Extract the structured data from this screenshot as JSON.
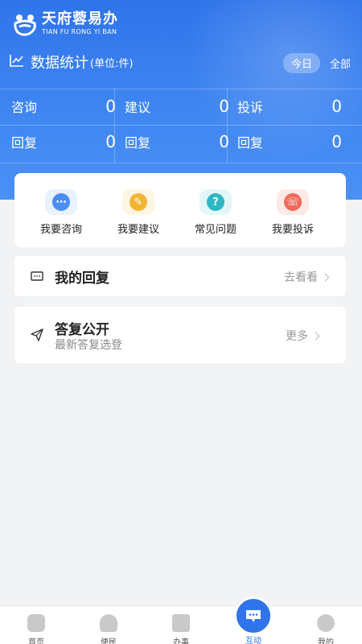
{
  "brand": {
    "name_cn": "天府蓉易办",
    "name_en": "TIAN FU RONG YI BAN"
  },
  "stats": {
    "title": "数据统计",
    "unit": "(单位:件)",
    "range_active": "今日",
    "range_all": "全部",
    "rows": [
      [
        {
          "label": "咨询",
          "value": "0"
        },
        {
          "label": "建议",
          "value": "0"
        },
        {
          "label": "投诉",
          "value": "0"
        }
      ],
      [
        {
          "label": "回复",
          "value": "0"
        },
        {
          "label": "回复",
          "value": "0"
        },
        {
          "label": "回复",
          "value": "0"
        }
      ]
    ]
  },
  "quick_actions": [
    {
      "label": "我要咨询",
      "icon": "consult-chat-icon",
      "color": "#4a8df5",
      "bg": "#eaf2ff"
    },
    {
      "label": "我要建议",
      "icon": "suggest-pencil-icon",
      "color": "#f3b534",
      "bg": "#fff5e3"
    },
    {
      "label": "常见问题",
      "icon": "faq-question-icon",
      "color": "#2fb7c4",
      "bg": "#e4f7f8"
    },
    {
      "label": "我要投诉",
      "icon": "complaint-icon",
      "color": "#f06a5a",
      "bg": "#fde9e6"
    }
  ],
  "my_reply": {
    "title": "我的回复",
    "action": "去看看"
  },
  "public_reply": {
    "title": "答复公开",
    "subtitle": "最新答复选登",
    "action": "更多"
  },
  "tabs": [
    {
      "label": "首页",
      "icon": "home-panda-icon",
      "active": false
    },
    {
      "label": "便民",
      "icon": "bell-icon",
      "active": false
    },
    {
      "label": "办事",
      "icon": "clipboard-icon",
      "active": false
    },
    {
      "label": "互动",
      "icon": "interact-chat-icon",
      "active": true
    },
    {
      "label": "我的",
      "icon": "profile-icon",
      "active": false
    }
  ],
  "colors": {
    "primary": "#2f74ea",
    "page_bg": "#f2f3f5"
  }
}
